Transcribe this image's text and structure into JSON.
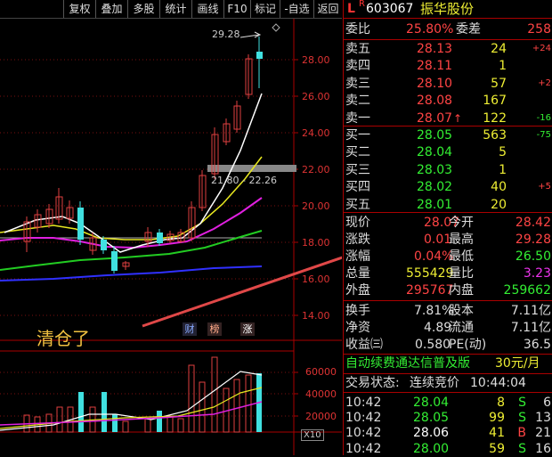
{
  "toolbar": {
    "buttons": [
      "复权",
      "叠加",
      "多股",
      "统计",
      "画线",
      "F10",
      "标记",
      "-自选",
      "返回"
    ]
  },
  "price_chart": {
    "y_ticks": [
      "28.00",
      "26.00",
      "24.00",
      "22.00",
      "20.00",
      "18.00",
      "16.00",
      "14.00"
    ],
    "high_label": "29.28",
    "range_label": "21.80 - 22.26",
    "annotation": "清仓了",
    "markers": [
      "财",
      "榜",
      "涨"
    ]
  },
  "volume_chart": {
    "y_ticks": [
      "60000",
      "40000",
      "20000"
    ],
    "unit_label": "X10"
  },
  "stock": {
    "flag_l": "L",
    "flag_r": "R",
    "code": "603067",
    "name": "振华股份"
  },
  "order_book": {
    "wei_bi_label": "委比",
    "wei_bi": "25.80%",
    "wei_cha_label": "委差",
    "wei_cha": "258",
    "asks": [
      {
        "label": "卖五",
        "price": "28.13",
        "vol": "24",
        "chg": "+24"
      },
      {
        "label": "卖四",
        "price": "28.11",
        "vol": "1",
        "chg": ""
      },
      {
        "label": "卖三",
        "price": "28.10",
        "vol": "57",
        "chg": "+2"
      },
      {
        "label": "卖二",
        "price": "28.08",
        "vol": "167",
        "chg": ""
      },
      {
        "label": "卖一",
        "price": "28.07",
        "vol": "122",
        "chg": "-16"
      }
    ],
    "bids": [
      {
        "label": "买一",
        "price": "28.05",
        "vol": "563",
        "chg": "-75"
      },
      {
        "label": "买二",
        "price": "28.04",
        "vol": "5",
        "chg": ""
      },
      {
        "label": "买三",
        "price": "28.03",
        "vol": "1",
        "chg": ""
      },
      {
        "label": "买四",
        "price": "28.02",
        "vol": "40",
        "chg": "+5"
      },
      {
        "label": "买五",
        "price": "28.01",
        "vol": "20",
        "chg": ""
      }
    ]
  },
  "quote": {
    "xian_jia_label": "现价",
    "xian_jia": "28.07",
    "jin_kai_label": "今开",
    "jin_kai": "28.42",
    "zhang_die_label": "涨跌",
    "zhang_die": "0.01",
    "zui_gao_label": "最高",
    "zui_gao": "29.28",
    "zhang_fu_label": "涨幅",
    "zhang_fu": "0.04%",
    "zui_di_label": "最低",
    "zui_di": "26.50",
    "zong_liang_label": "总量",
    "zong_liang": "555429",
    "liang_bi_label": "量比",
    "liang_bi": "3.23",
    "wai_pan_label": "外盘",
    "wai_pan": "295767",
    "nei_pan_label": "内盘",
    "nei_pan": "259662",
    "huan_shou_label": "换手",
    "huan_shou": "7.81%",
    "gu_ben_label": "股本",
    "gu_ben": "7.11亿",
    "jing_zi_label": "净资",
    "jing_zi": "4.89",
    "liu_tong_label": "流通",
    "liu_tong": "7.11亿",
    "shou_yi_label": "收益㈢",
    "shou_yi": "0.580",
    "pe_label": "PE(动)",
    "pe": "36.5"
  },
  "promo": {
    "text": "自动续费通达信普及版",
    "price": "30元/月"
  },
  "trade": {
    "status_label": "交易状态:",
    "status": "连续竞价",
    "time": "10:44:04"
  },
  "ticks": [
    {
      "time": "10:42",
      "price": "28.04",
      "vol": "8",
      "side": "S",
      "n": "6"
    },
    {
      "time": "10:42",
      "price": "28.05",
      "vol": "99",
      "side": "S",
      "n": "13"
    },
    {
      "time": "10:42",
      "price": "28.06",
      "vol": "41",
      "side": "B",
      "n": "21"
    },
    {
      "time": "10:42",
      "price": "28.00",
      "vol": "59",
      "side": "S",
      "n": "16"
    }
  ]
}
